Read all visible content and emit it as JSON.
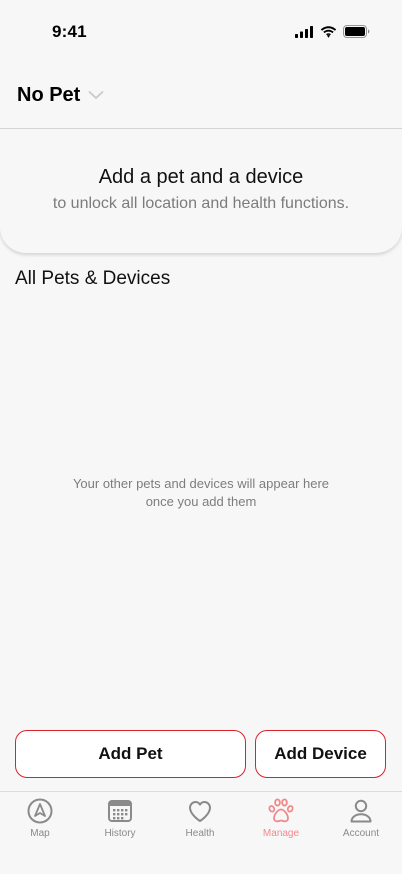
{
  "status_bar": {
    "time": "9:41"
  },
  "header": {
    "pet_selector_label": "No Pet"
  },
  "banner": {
    "title": "Add a pet and a device",
    "subtitle": "to unlock all location and health functions."
  },
  "section": {
    "title": "All Pets & Devices"
  },
  "empty_state": {
    "line1": "Your other pets and devices will appear here",
    "line2": "once you add them"
  },
  "actions": {
    "add_pet": "Add Pet",
    "add_device": "Add Device"
  },
  "tabs": [
    {
      "label": "Map",
      "icon": "map-compass-icon"
    },
    {
      "label": "History",
      "icon": "calendar-icon"
    },
    {
      "label": "Health",
      "icon": "heart-icon"
    },
    {
      "label": "Manage",
      "icon": "paw-icon",
      "active": true
    },
    {
      "label": "Account",
      "icon": "person-icon"
    }
  ],
  "colors": {
    "accent": "#d9232b",
    "active_tab": "#ef8a8c",
    "inactive_tab": "#8a8a8a",
    "background": "#f7f7f7"
  }
}
